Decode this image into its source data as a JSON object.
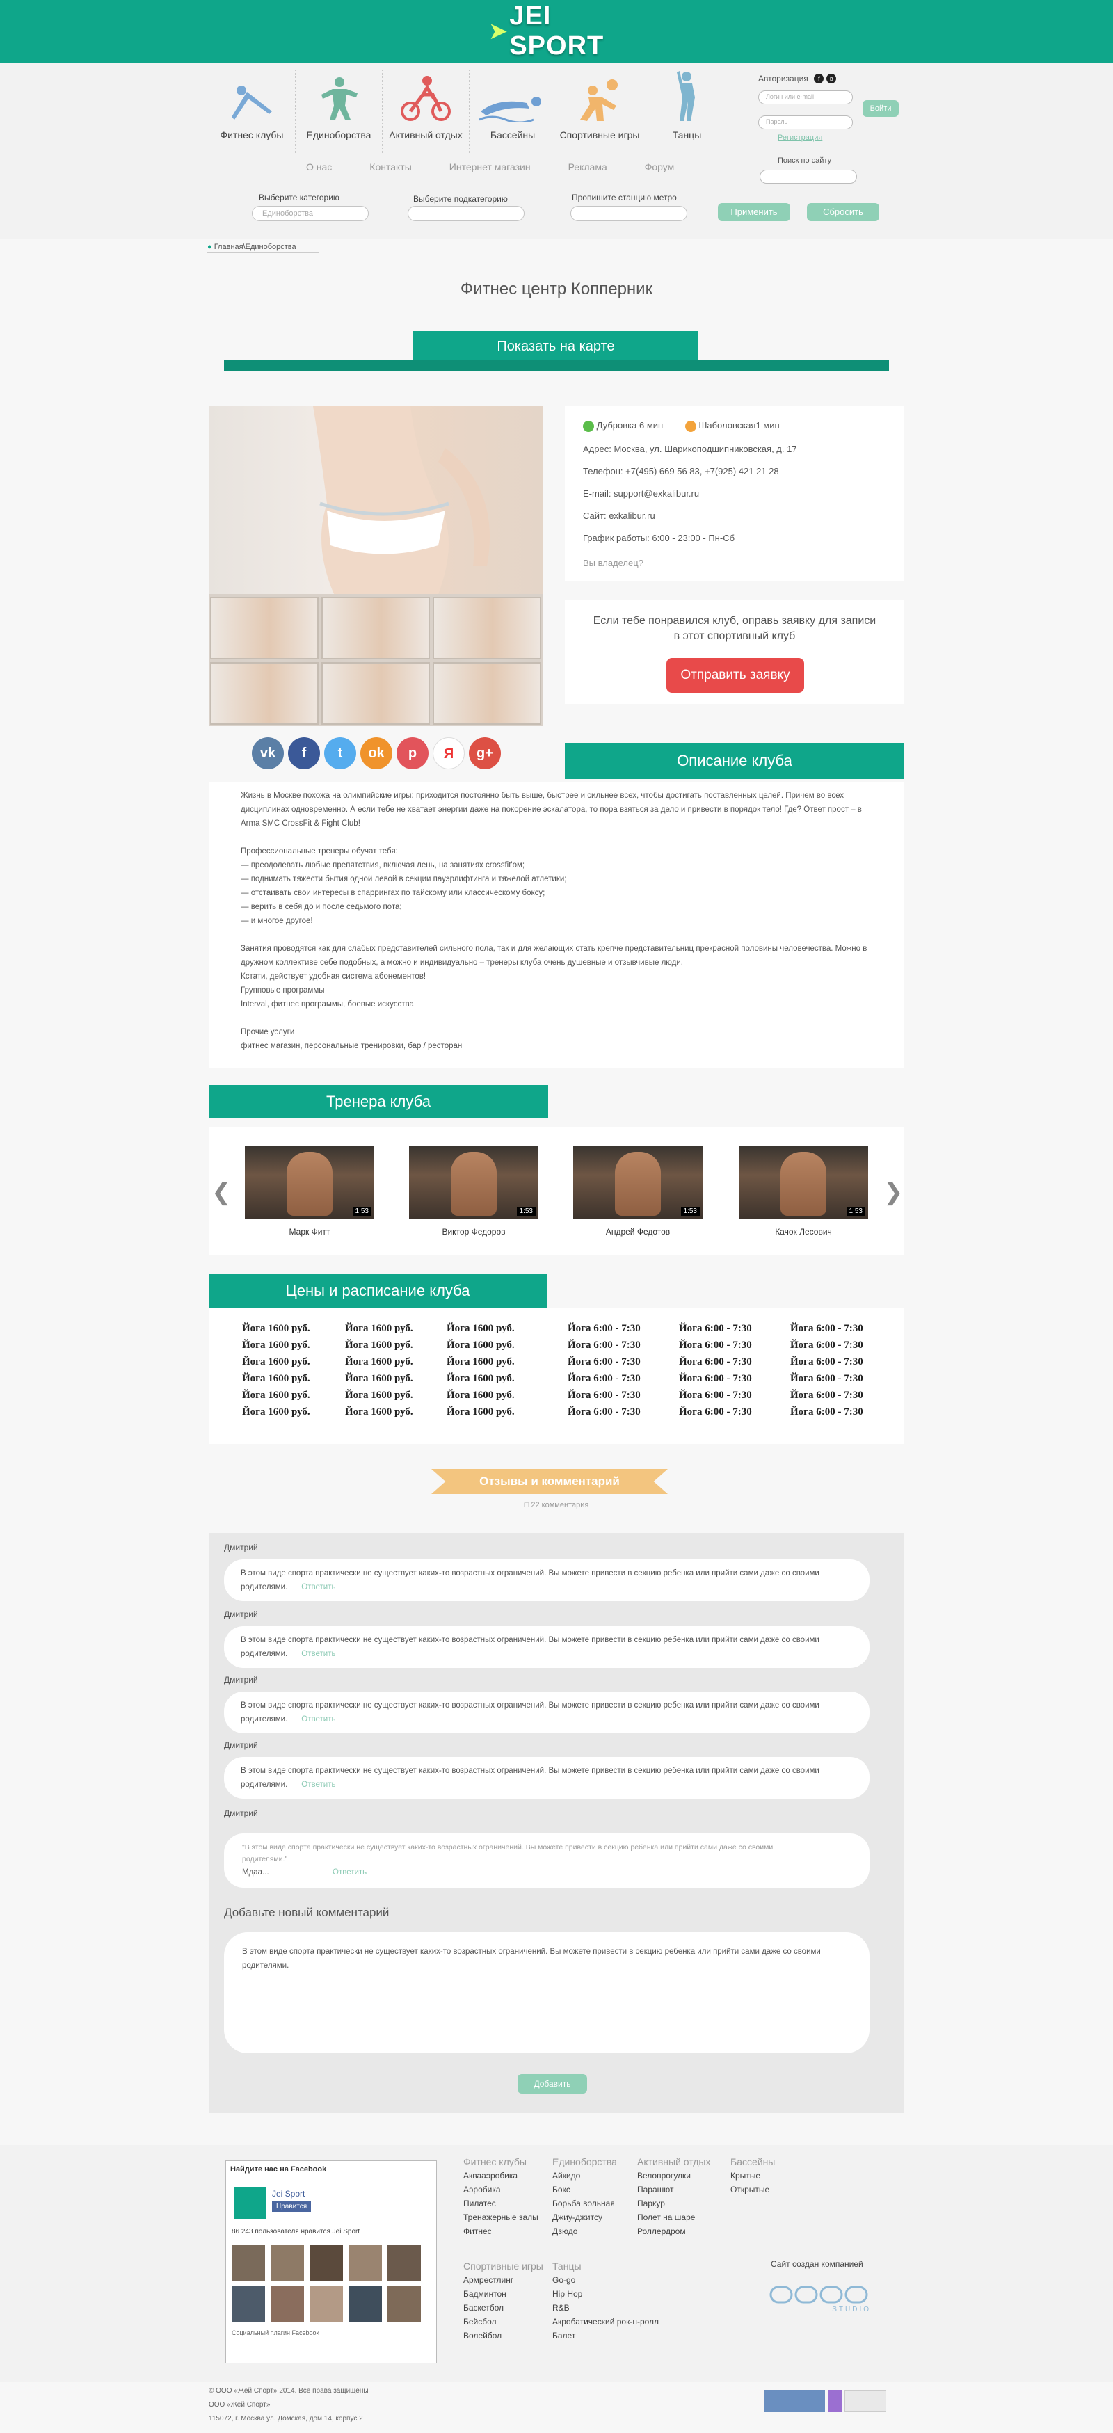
{
  "header": {
    "logo_text": "JEI SPORT"
  },
  "categories": [
    {
      "label": "Фитнес клубы",
      "icon": "fitness-icon",
      "color": "#7aa9d6"
    },
    {
      "label": "Единоборства",
      "icon": "martial-arts-icon",
      "color": "#6fb59d"
    },
    {
      "label": "Активный отдых",
      "icon": "bike-icon",
      "color": "#e05b5b"
    },
    {
      "label": "Бассейны",
      "icon": "swimmer-icon",
      "color": "#6f9fd3"
    },
    {
      "label": "Спортивные игры",
      "icon": "volleyball-icon",
      "color": "#f1b56b"
    },
    {
      "label": "Танцы",
      "icon": "dancer-icon",
      "color": "#7fb5cf"
    }
  ],
  "auth": {
    "title": "Авторизация",
    "login_placeholder": "Логин или e-mail",
    "password_placeholder": "Пароль",
    "submit": "Войти",
    "register": "Регистрация"
  },
  "nav": [
    "О нас",
    "Контакты",
    "Интернет магазин",
    "Реклама",
    "Форум"
  ],
  "search": {
    "label": "Поиск по сайту"
  },
  "filters": {
    "category_label": "Выберите категорию",
    "category_value": "Единоборства",
    "subcategory_label": "Выберите подкатегорию",
    "metro_label": "Пропишите станцию метро",
    "apply": "Применить",
    "reset": "Сбросить"
  },
  "breadcrumb": "Главная\\Единоборства",
  "page_title": "Фитнес центр Копперник",
  "map_button": "Показать на карте",
  "info": {
    "metro1": "Дубровка 6 мин",
    "metro2": "Шаболовская1 мин",
    "address": "Адрес: Москва, ул. Шарикоподшипниковская, д. 17",
    "phone": "Телефон: +7(495) 669 56 83, +7(925) 421 21 28",
    "email": "E-mail: support@exkalibur.ru",
    "site": "Сайт: exkalibur.ru",
    "schedule": "График работы: 6:00 - 23:00 - Пн-Сб",
    "owner": "Вы владелец?"
  },
  "request": {
    "text_line1": "Если тебе понравился клуб, оправь заявку для записи",
    "text_line2": "в этот спортивный клуб",
    "button": "Отправить заявку"
  },
  "shares": [
    {
      "glyph": "vk",
      "color": "#5b7fa6"
    },
    {
      "glyph": "f",
      "color": "#3b5998"
    },
    {
      "glyph": "t",
      "color": "#55acee"
    },
    {
      "glyph": "ok",
      "color": "#f0932b"
    },
    {
      "glyph": "p",
      "color": "#e2545b"
    },
    {
      "glyph": "Я",
      "color": "#ffffff"
    },
    {
      "glyph": "g+",
      "color": "#dd5044"
    }
  ],
  "description": {
    "title": "Описание клуба",
    "text": "Жизнь в Москве похожа на олимпийские игры: приходится постоянно быть выше, быстрее и сильнее всех, чтобы достигать поставленных целей. Причем во всех дисциплинах одновременно. А если тебе не хватает энергии даже на покорение эскалатора, то пора взяться за дело и привести в порядок тело! Где? Ответ прост – в Arma SMC CrossFit & Fight Club!\n\nПрофессиональные тренеры обучат тебя:\n— преодолевать любые препятствия, включая лень, на занятиях crossfit'ом;\n— поднимать тяжести бытия одной левой в секции пауэрлифтинга и тяжелой атлетики;\n— отстаивать свои интересы в спаррингах по тайскому или классическому боксу;\n— верить в себя до и после седьмого пота;\n— и многое другое!\n\nЗанятия проводятся как для слабых представителей сильного пола, так и для желающих стать крепче представительниц прекрасной половины человечества. Можно в дружном коллективе себе подобных, а можно и индивидуально – тренеры клуба очень душевные и отзывчивые люди.\nКстати, действует удобная система абонементов!\nГрупповые программы\nInterval, фитнес программы, боевые искусства\n\nПрочие услуги\nфитнес магазин, персональные тренировки, бар / ресторан"
  },
  "trainers": {
    "title": "Тренера клуба",
    "items": [
      {
        "name": "Марк Фитт",
        "duration": "1:53"
      },
      {
        "name": "Виктор Федоров",
        "duration": "1:53"
      },
      {
        "name": "Андрей Федотов",
        "duration": "1:53"
      },
      {
        "name": "Качок Лесович",
        "duration": "1:53"
      }
    ]
  },
  "prices": {
    "title": "Цены и расписание клуба",
    "price_item": "Йога 1600 руб.",
    "time_item": "Йога 6:00 - 7:30"
  },
  "reviews": {
    "title": "Отзывы и комментарий",
    "count": "22 комментария",
    "comments": [
      {
        "author": "Дмитрий",
        "text": "В этом виде спорта практически не существует каких-то возрастных ограничений. Вы можете привести в секцию ребенка или прийти сами даже со своими родителями.",
        "reply": "Ответить"
      },
      {
        "author": "Дмитрий",
        "text": "В этом виде спорта практически не существует каких-то возрастных ограничений. Вы можете привести в секцию ребенка или прийти сами даже со своими родителями.",
        "reply": "Ответить"
      },
      {
        "author": "Дмитрий",
        "text": "В этом виде спорта практически не существует каких-то возрастных ограничений. Вы можете привести в секцию ребенка или прийти сами даже со своими родителями.",
        "reply": "Ответить"
      },
      {
        "author": "Дмитрий",
        "text": "В этом виде спорта практически не существует каких-то возрастных ограничений. Вы можете привести в секцию ребенка или прийти сами даже со своими родителями.",
        "reply": "Ответить"
      }
    ],
    "quoted": {
      "author": "Дмитрий",
      "quote": "\"В этом виде спорта практически не существует каких-то возрастных ограничений. Вы можете привести в секцию ребенка или прийти сами даже со своими родителями.\"",
      "reply": "Ответить",
      "text": "Мдаа..."
    },
    "add_label": "Добавьте новый комментарий",
    "add_text": "В этом виде спорта практически не существует каких-то возрастных ограничений. Вы можете привести в секцию ребенка или прийти сами даже со своими родителями.",
    "add_button": "Добавить"
  },
  "footer": {
    "fb_title": "Найдите нас на Facebook",
    "fb_page": "Jei Sport",
    "fb_like": "Нравится",
    "fb_count": "86 243 пользователя нравится Jei Sport",
    "fb_plugin": "Социальный плагин Facebook",
    "col1": {
      "h": "Фитнес клубы",
      "items": [
        "Аквааэробика",
        "Аэробика",
        "Пилатес",
        "Тренажерные залы",
        "Фитнес"
      ]
    },
    "col2": {
      "h": "Единоборства",
      "items": [
        "Айкидо",
        "Бокс",
        "Борьба вольная",
        "Джиу-джитсу",
        "Дзюдо"
      ]
    },
    "col3": {
      "h": "Активный отдых",
      "items": [
        "Велопрогулки",
        "Парашют",
        "Паркур",
        "Полет на шаре",
        "Роллердром"
      ]
    },
    "col4": {
      "h": "Бассейны",
      "items": [
        "Крытые",
        "Открытые"
      ]
    },
    "col5": {
      "h": "Спортивные игры",
      "items": [
        "Армрестлинг",
        "Бадминтон",
        "Баскетбол",
        "Бейсбол",
        "Волейбол"
      ]
    },
    "col6": {
      "h": "Танцы",
      "items": [
        "Go-go",
        "Hip Hop",
        "R&B",
        "Акробатический рок-н-ролл",
        "Балет"
      ]
    },
    "created_by": "Сайт создан компанией",
    "studio": "STUDIO",
    "copyright1": "© ООО «Жей Спорт» 2014. Все права защищены",
    "copyright2": "ООО «Жей Спорт»",
    "copyright3": "115072, г. Москва ул. Домская, дом 14, корпус 2"
  }
}
